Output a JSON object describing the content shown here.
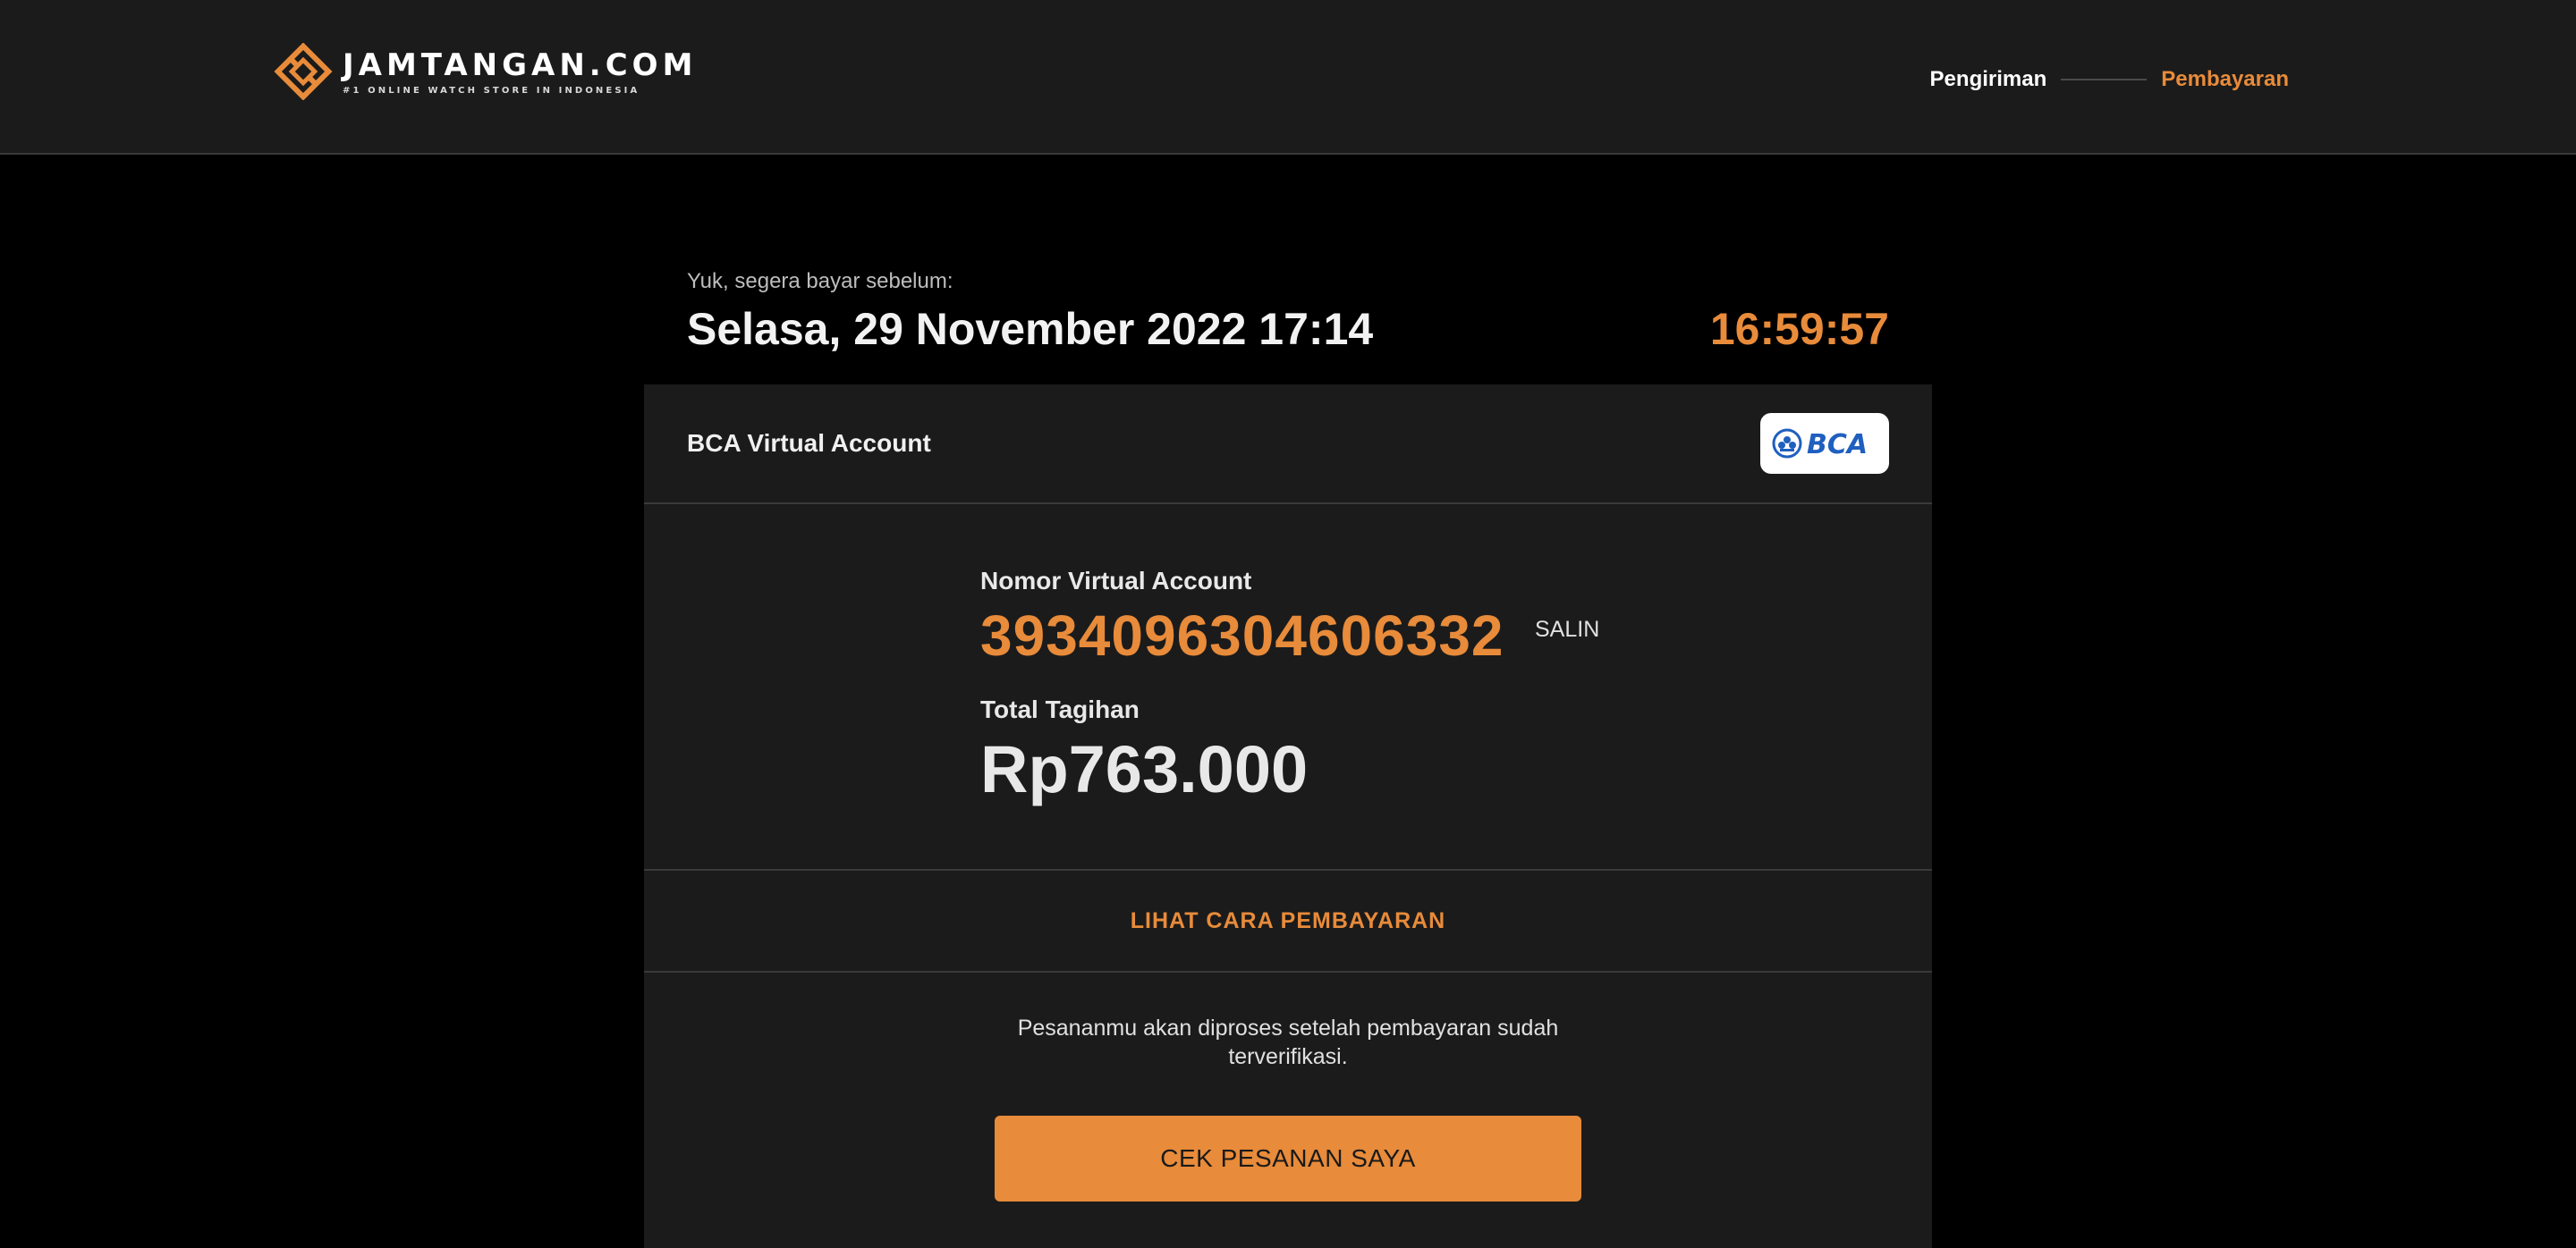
{
  "header": {
    "brand_name": "JAMTANGAN.COM",
    "brand_tagline": "#1 ONLINE WATCH STORE IN INDONESIA",
    "steps": [
      {
        "label": "Pengiriman",
        "state": "done"
      },
      {
        "label": "Pembayaran",
        "state": "active"
      }
    ]
  },
  "deadline": {
    "label": "Yuk, segera bayar sebelum:",
    "date": "Selasa, 29 November 2022 17:14",
    "countdown": "16:59:57"
  },
  "payment": {
    "method_name": "BCA Virtual Account",
    "bank_logo_text": "BCA",
    "va_label": "Nomor Virtual Account",
    "va_number": "3934096304606332",
    "copy_label": "SALIN",
    "total_label": "Total Tagihan",
    "total_amount": "Rp763.000",
    "howto_label": "LIHAT CARA PEMBAYARAN",
    "note": "Pesananmu akan diproses setelah pembayaran sudah terverifikasi.",
    "cta_label": "CEK PESANAN SAYA"
  },
  "colors": {
    "accent": "#e88b3a",
    "background": "#000000",
    "surface": "#1b1b1b",
    "divider": "#3a3a3a",
    "bca_blue": "#1f5fbf"
  },
  "icons": {
    "brand": "jamtangan-logo-icon",
    "bank": "bca-logo-icon"
  }
}
